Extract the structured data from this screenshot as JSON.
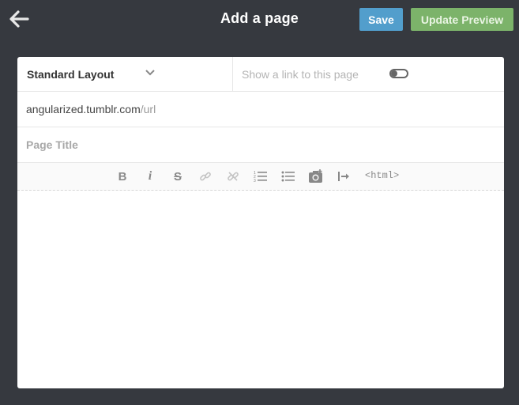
{
  "header": {
    "title": "Add a page",
    "save_label": "Save",
    "preview_label": "Update Preview",
    "back_icon": "arrow-left-icon"
  },
  "form": {
    "layout_label": "Standard Layout",
    "show_link_label": "Show a link to this page",
    "show_link_enabled": false,
    "url_domain": "angularized.tumblr.com",
    "url_suffix": "/url",
    "title_placeholder": "Page Title",
    "title_value": ""
  },
  "toolbar": {
    "bold_label": "B",
    "italic_label": "i",
    "strike_label": "S",
    "html_label": "<html>",
    "icons": [
      "bold-icon",
      "italic-icon",
      "strikethrough-icon",
      "link-icon",
      "unlink-icon",
      "ordered-list-icon",
      "unordered-list-icon",
      "camera-icon",
      "read-more-icon",
      "html-icon"
    ]
  },
  "colors": {
    "background": "#36393f",
    "save_button": "#529ecc",
    "preview_button": "#7cb36a"
  }
}
